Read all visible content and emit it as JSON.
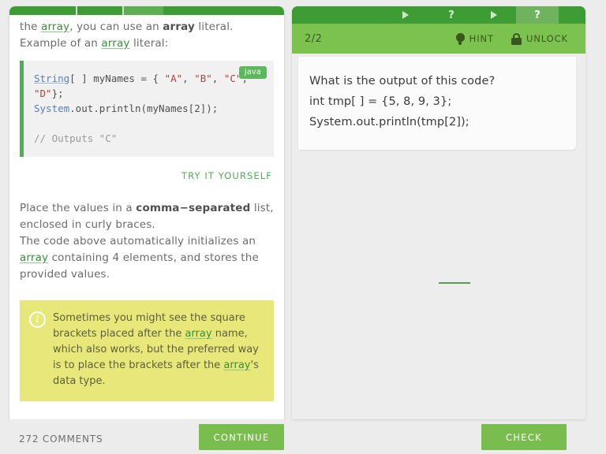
{
  "left": {
    "intro_before": "the ",
    "intro_link1": "array",
    "intro_mid": ", you can use an ",
    "intro_bold": "array",
    "intro_after": " literal.",
    "intro_line2_before": "Example of an ",
    "intro_line2_link": "array",
    "intro_line2_after": " literal:",
    "code": {
      "badge": "java",
      "l1_type": "String",
      "l1_rest": "[ ] myNames = { ",
      "l1_s1": "\"A\"",
      "l1_c1": ", ",
      "l1_s2": "\"B\"",
      "l1_c2": ", ",
      "l1_s3": "\"C\"",
      "l1_c3": ",",
      "l2_s4": "\"D\"",
      "l2_rest": "};",
      "l3_ident": "System",
      "l3_rest": ".out.println(myNames[2]);",
      "l4_comment": "// Outputs \"C\""
    },
    "try_it_label": "TRY IT YOURSELF",
    "body_line1_a": "Place the values in a ",
    "body_line1_bold": "comma−separated",
    "body_line1_b": " list,",
    "body_line2": "enclosed in curly braces.",
    "body_line3": "The code above automatically initializes an",
    "body_line4_link": "array",
    "body_line4_rest": " containing 4 elements, and stores the",
    "body_line5": "provided values.",
    "note": {
      "icon": "info-icon",
      "text_a": "Sometimes you might see the square brackets placed after the ",
      "link1": "array",
      "text_b": " name, which also works, but the preferred way is to place the brackets after the ",
      "link2": "array",
      "text_c": "'s data type."
    },
    "comments_label": "272 COMMENTS",
    "continue_label": "CONTINUE"
  },
  "right": {
    "progress": {
      "segments": [
        {
          "type": "plain",
          "state": "done"
        },
        {
          "type": "triangle",
          "state": "done",
          "icon": "play-triangle-icon"
        },
        {
          "type": "question",
          "state": "done",
          "icon": "question-mark-icon"
        },
        {
          "type": "triangle",
          "state": "done",
          "icon": "play-triangle-icon"
        },
        {
          "type": "question",
          "state": "current",
          "icon": "question-mark-icon"
        },
        {
          "type": "plain",
          "state": "done"
        }
      ]
    },
    "step_counter": "2/2",
    "hint_label": "HINT",
    "hint_icon": "lightbulb-icon",
    "unlock_label": "UNLOCK",
    "unlock_icon": "padlock-icon",
    "question_text": "What is the output of this code?\nint tmp[ ] = {5, 8, 9, 3};\nSystem.out.println(tmp[2]);",
    "answer_value": "",
    "check_label": "CHECK"
  },
  "colors": {
    "brand_green": "#79bd4e",
    "dark_green": "#3e9c35",
    "toolbar_green": "#7cc24f",
    "note_yellow": "#e8e87a",
    "link_green": "#3c8c3c",
    "page_bg": "#ececec"
  }
}
